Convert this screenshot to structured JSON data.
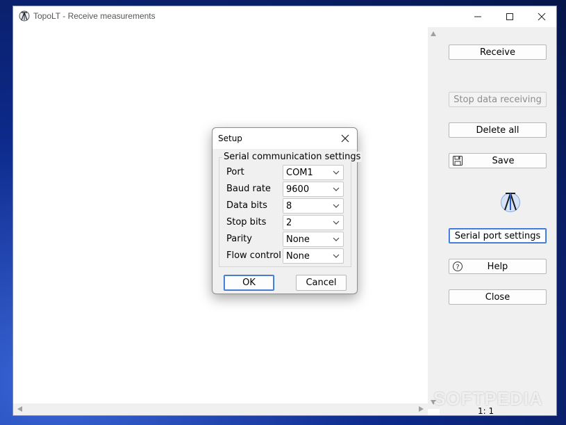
{
  "window": {
    "title": "TopoLT - Receive measurements",
    "controls": {
      "minimize": "—",
      "maximize": "☐",
      "close": "✕"
    }
  },
  "sidebar": {
    "receive": "Receive",
    "stop": "Stop data receiving",
    "delete_all": "Delete all",
    "save": "Save",
    "serial_port_settings": "Serial port settings",
    "help": "Help",
    "close": "Close"
  },
  "status": {
    "position": "1: 1"
  },
  "watermark": "SOFTPEDIA",
  "dialog": {
    "title": "Setup",
    "group_title": "Serial communication settings",
    "fields": [
      {
        "label": "Port",
        "value": "COM1"
      },
      {
        "label": "Baud rate",
        "value": "9600"
      },
      {
        "label": "Data bits",
        "value": "8"
      },
      {
        "label": "Stop bits",
        "value": "2"
      },
      {
        "label": "Parity",
        "value": "None"
      },
      {
        "label": "Flow control",
        "value": "None"
      }
    ],
    "ok": "OK",
    "cancel": "Cancel"
  },
  "icons": {
    "app": "tripod-icon",
    "save": "floppy-disk-icon",
    "help": "question-circle-icon",
    "logo": "tripod-logo-icon"
  },
  "colors": {
    "accent": "#2f6ed1",
    "panel": "#f0f0f0",
    "logo": "#2a5ec4"
  }
}
